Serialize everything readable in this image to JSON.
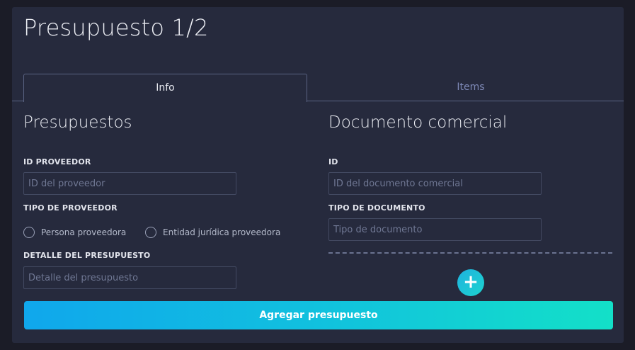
{
  "header": {
    "title": "Presupuesto 1/2"
  },
  "tabs": [
    {
      "label": "Info"
    },
    {
      "label": "Items"
    }
  ],
  "left": {
    "title": "Presupuestos",
    "proveedor_id": {
      "label": "ID PROVEEDOR",
      "placeholder": "ID del proveedor",
      "value": ""
    },
    "tipo_proveedor": {
      "label": "TIPO DE PROVEEDOR",
      "options": [
        "Persona proveedora",
        "Entidad jurídica proveedora"
      ]
    },
    "detalle": {
      "label": "DETALLE DEL PRESUPUESTO",
      "placeholder": "Detalle del presupuesto",
      "value": ""
    }
  },
  "right": {
    "title": "Documento comercial",
    "doc_id": {
      "label": "ID",
      "placeholder": "ID del documento comercial",
      "value": ""
    },
    "tipo_doc": {
      "label": "TIPO DE DOCUMENTO",
      "placeholder": "Tipo de documento",
      "value": ""
    },
    "add_icon": "plus-icon",
    "add_symbol": "+"
  },
  "submit": {
    "label": "Agregar presupuesto"
  },
  "colors": {
    "background": "#1b1c27",
    "card": "#262a3d",
    "accent_start": "#10a7ec",
    "accent_end": "#13e0c8"
  }
}
